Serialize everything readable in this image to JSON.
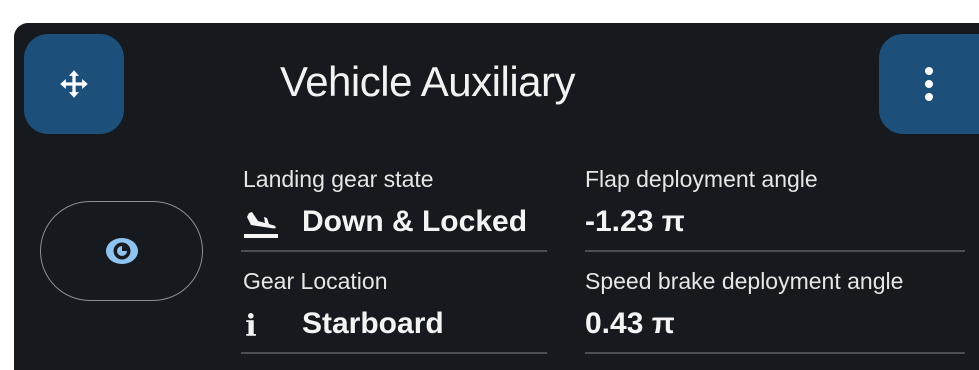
{
  "card": {
    "title": "Vehicle Auxiliary",
    "drag_icon": "move-arrows-icon",
    "menu_icon": "kebab-menu-icon",
    "toggle_icon": "eye-icon"
  },
  "fields": [
    {
      "label": "Landing gear state",
      "value": "Down & Locked",
      "icon": "plane-landing-icon"
    },
    {
      "label": "Gear Location",
      "value": "Starboard",
      "icon": "info-icon"
    },
    {
      "label": "Flap deployment angle",
      "value": "-1.23 π"
    },
    {
      "label": "Speed brake deployment angle",
      "value": "0.43 π"
    }
  ],
  "colors": {
    "card_bg": "#16191d",
    "button_bg": "#1c4f79",
    "text": "#f2f2f2"
  }
}
